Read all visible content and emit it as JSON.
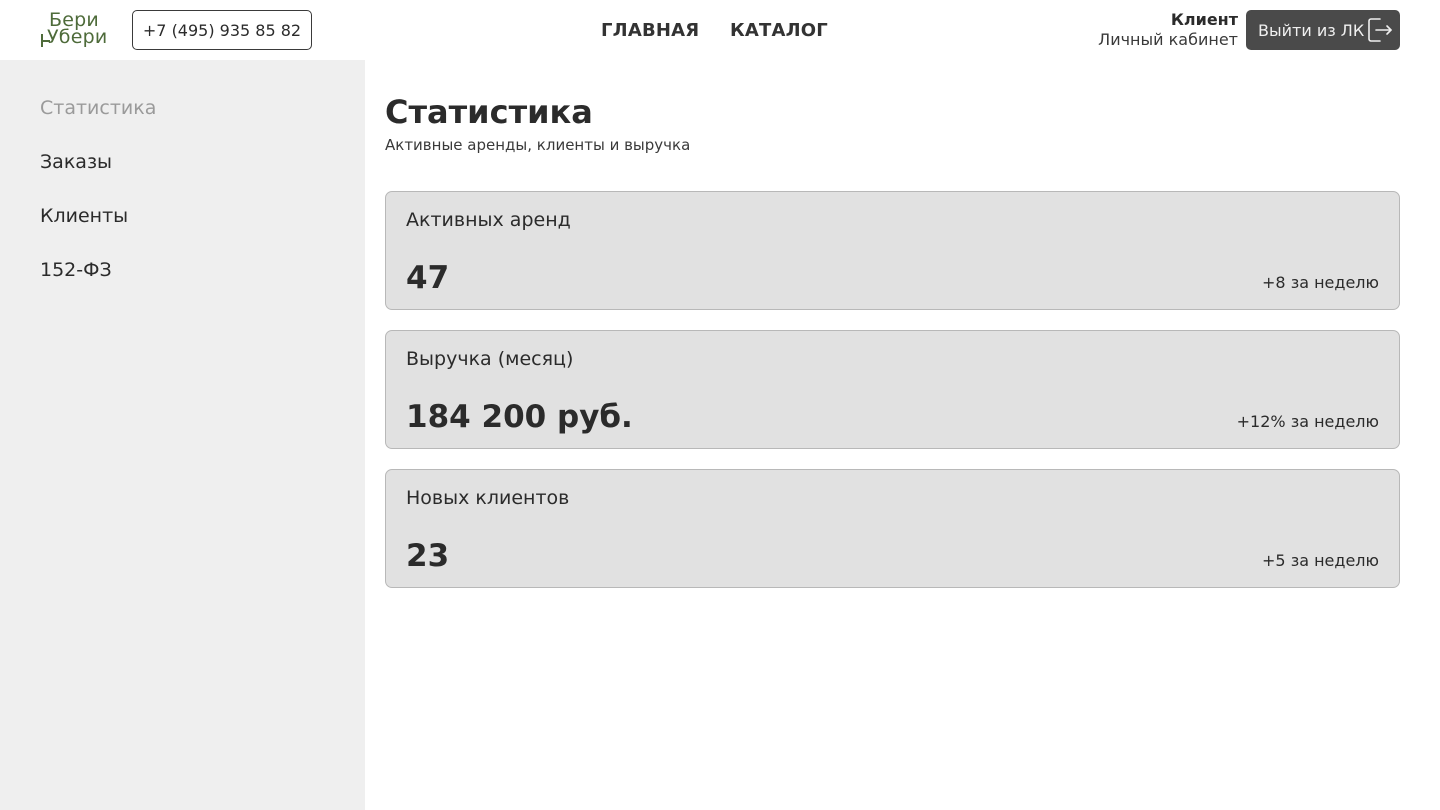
{
  "header": {
    "logo": {
      "line1": "Бери",
      "line2": "Убери"
    },
    "phone": "+7 (495) 935 85 82",
    "nav": [
      {
        "label": "ГЛАВНАЯ"
      },
      {
        "label": "КАТАЛОГ"
      }
    ],
    "user": {
      "name": "Клиент",
      "role": "Личный кабинет"
    },
    "logout_label": "Выйти из ЛК",
    "logout_icon": "logout-icon",
    "brand_color": "#4e6b3a"
  },
  "sidebar": {
    "items": [
      {
        "label": "Статистика",
        "active": true
      },
      {
        "label": "Заказы",
        "active": false
      },
      {
        "label": "Клиенты",
        "active": false
      },
      {
        "label": "152-ФЗ",
        "active": false
      }
    ]
  },
  "main": {
    "title": "Статистика",
    "subtitle": "Активные аренды, клиенты и выручка",
    "cards": [
      {
        "label": "Активных аренд",
        "value": "47",
        "delta": "+8 за неделю"
      },
      {
        "label": "Выручка (месяц)",
        "value": "184 200 руб.",
        "delta": "+12% за неделю"
      },
      {
        "label": "Новых клиентов",
        "value": "23",
        "delta": "+5 за неделю"
      }
    ]
  }
}
